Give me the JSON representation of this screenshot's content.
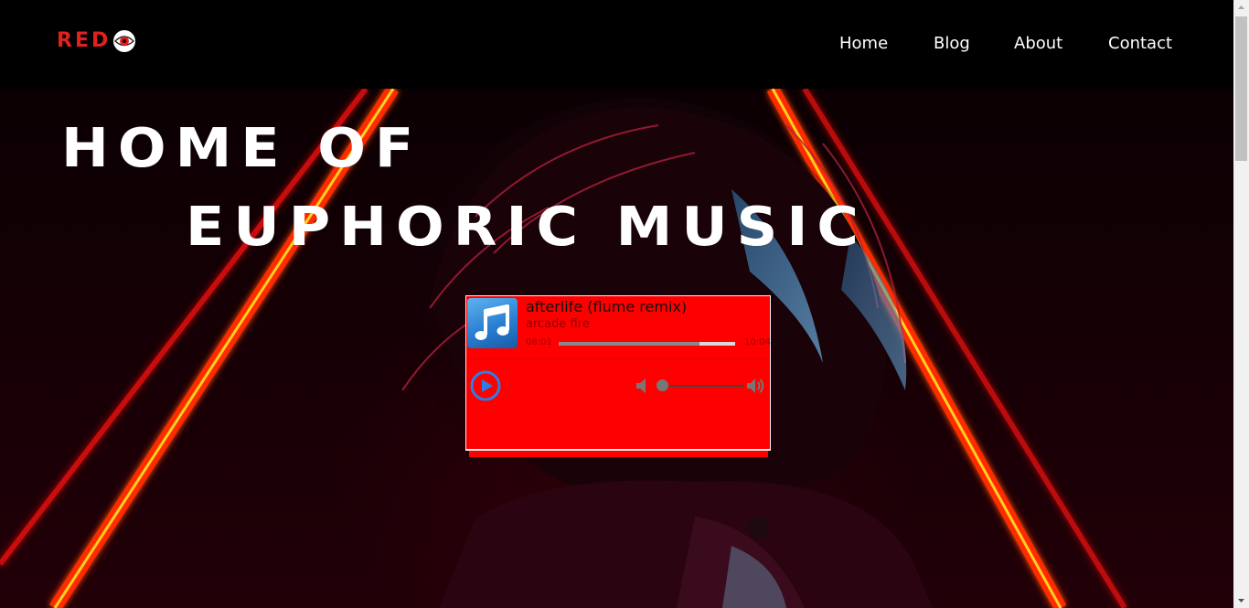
{
  "brand": {
    "logo_text": "RED",
    "accent_color": "#e0211d"
  },
  "nav": {
    "items": [
      {
        "label": "Home"
      },
      {
        "label": "Blog"
      },
      {
        "label": "About"
      },
      {
        "label": "Contact"
      }
    ]
  },
  "hero": {
    "title_line1": "HOME  OF",
    "title_line2": "EUPHORIC  MUSIC"
  },
  "player": {
    "track_title": "afterlife (flume remix)",
    "artist": "arcade fire",
    "time_elapsed": "08:01",
    "time_total": "10:04",
    "progress_fraction": 0.8,
    "volume_fraction": 0.0,
    "cover_icon": "music-note-icon",
    "play_icon": "play-circle-icon",
    "background_color": "#ff0000"
  }
}
